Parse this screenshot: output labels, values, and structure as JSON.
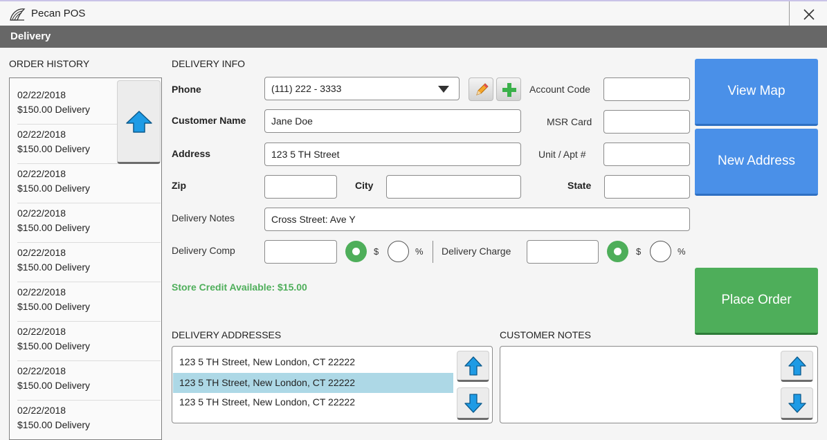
{
  "app": {
    "title": "Pecan POS",
    "section": "Delivery"
  },
  "order_history": {
    "header": "ORDER HISTORY",
    "items": [
      {
        "date": "02/22/2018",
        "desc": "$150.00 Delivery"
      },
      {
        "date": "02/22/2018",
        "desc": "$150.00 Delivery"
      },
      {
        "date": "02/22/2018",
        "desc": "$150.00 Delivery"
      },
      {
        "date": "02/22/2018",
        "desc": "$150.00 Delivery"
      },
      {
        "date": "02/22/2018",
        "desc": "$150.00 Delivery"
      },
      {
        "date": "02/22/2018",
        "desc": "$150.00 Delivery"
      },
      {
        "date": "02/22/2018",
        "desc": "$150.00 Delivery"
      },
      {
        "date": "02/22/2018",
        "desc": "$150.00 Delivery"
      },
      {
        "date": "02/22/2018",
        "desc": "$150.00 Delivery"
      }
    ]
  },
  "delivery_info": {
    "header": "DELIVERY INFO",
    "phone_label": "Phone",
    "phone_value": "(111) 222 - 3333",
    "account_code_label": "Account Code",
    "account_code_value": "",
    "customer_name_label": "Customer Name",
    "customer_name_value": "Jane Doe",
    "msr_card_label": "MSR Card",
    "msr_card_value": "",
    "address_label": "Address",
    "address_value": "123 5 TH Street",
    "unit_label": "Unit / Apt #",
    "unit_value": "",
    "zip_label": "Zip",
    "zip_value": "",
    "city_label": "City",
    "city_value": "",
    "state_label": "State",
    "state_value": "",
    "notes_label": "Delivery Notes",
    "notes_value": "Cross Street: Ave Y",
    "comp_label": "Delivery Comp",
    "comp_value": "",
    "comp_unit_selected": "$",
    "charge_label": "Delivery Charge",
    "charge_value": "",
    "charge_unit_selected": "$",
    "dollar_symbol": "$",
    "percent_symbol": "%",
    "store_credit": "Store Credit Available: $15.00"
  },
  "actions": {
    "view_map": "View Map",
    "new_address": "New Address",
    "place_order": "Place Order"
  },
  "delivery_addresses": {
    "header": "DELIVERY ADDRESSES",
    "items": [
      "123 5 TH Street, New London, CT 22222",
      "123 5 TH Street, New London, CT 22222",
      "123 5 TH Street, New London, CT 22222"
    ],
    "selected_index": 1
  },
  "customer_notes": {
    "header": "CUSTOMER NOTES",
    "value": ""
  },
  "colors": {
    "accent_blue": "#4a90e8",
    "accent_green": "#4eae5a",
    "header_bar": "#676767",
    "selection": "#add8e6",
    "arrow_blue": "#1e9be5"
  },
  "icons": {
    "logo": "pecan-logo-icon",
    "close": "close-icon",
    "dropdown": "dropdown-arrow-icon",
    "edit": "pencil-icon",
    "add": "plus-icon",
    "scroll_up": "arrow-up-icon",
    "scroll_down": "arrow-down-icon"
  }
}
